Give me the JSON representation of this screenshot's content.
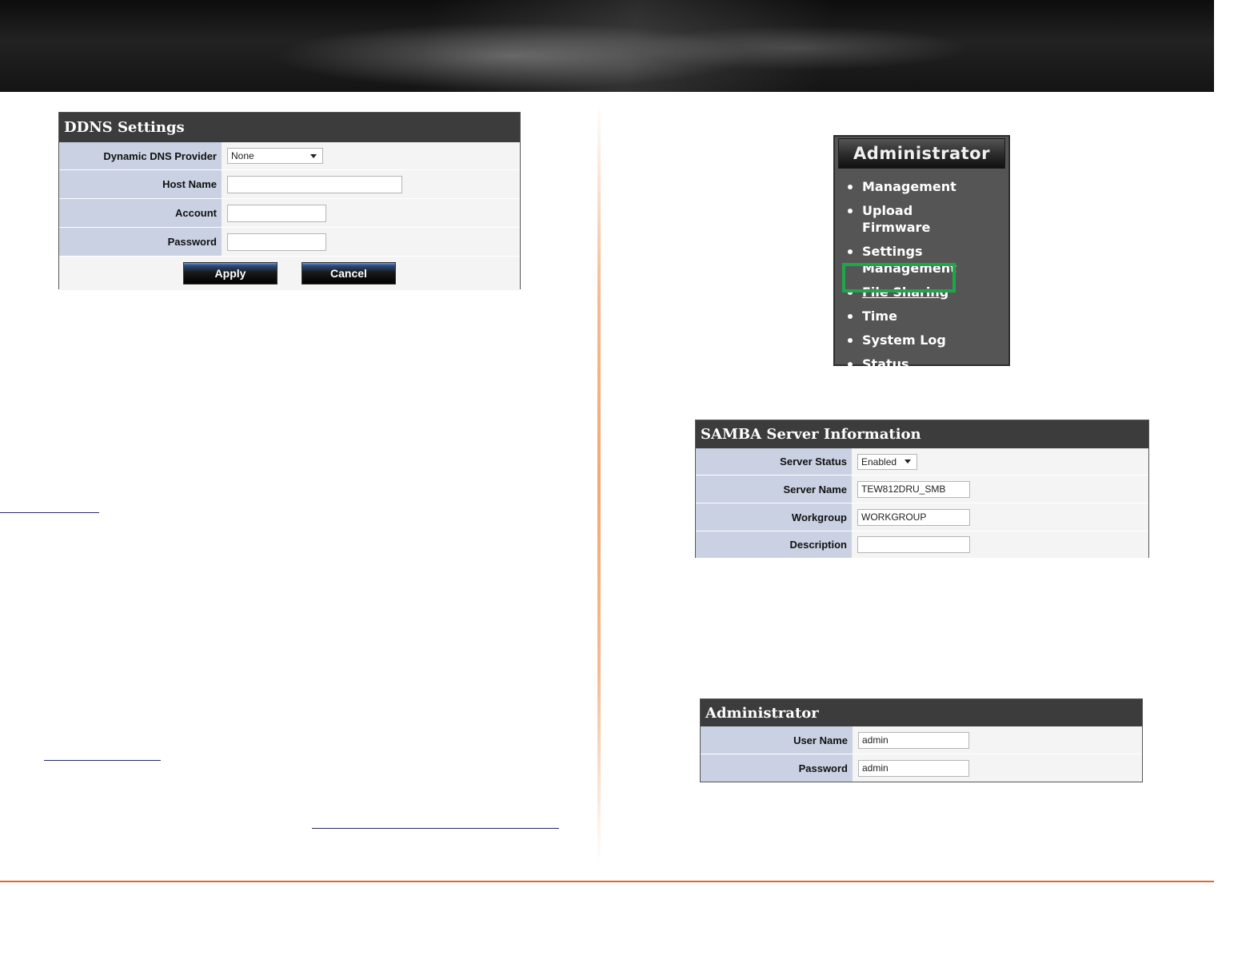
{
  "ddns": {
    "title": "DDNS Settings",
    "provider_label": "Dynamic DNS Provider",
    "provider_value": "None",
    "host_label": "Host Name",
    "host_value": "",
    "account_label": "Account",
    "account_value": "",
    "password_label": "Password",
    "password_value": "",
    "apply_label": "Apply",
    "cancel_label": "Cancel"
  },
  "admin_menu": {
    "title": "Administrator",
    "items": [
      "Management",
      "Upload Firmware",
      "Settings Management",
      "File Sharing",
      "Time",
      "System Log",
      "Status"
    ],
    "active_item": "File Sharing",
    "highlight_color": "#1fa64a"
  },
  "samba": {
    "title": "SAMBA Server Information",
    "status_label": "Server Status",
    "status_value": "Enabled",
    "name_label": "Server Name",
    "name_value": "TEW812DRU_SMB",
    "workgroup_label": "Workgroup",
    "workgroup_value": "WORKGROUP",
    "description_label": "Description",
    "description_value": ""
  },
  "admin_creds": {
    "title": "Administrator",
    "user_label": "User Name",
    "user_value": "admin",
    "password_label": "Password",
    "password_value": "admin"
  },
  "colors": {
    "panel_title_bg": "#3c3c3c",
    "label_bg": "#c9d1e3",
    "accent_orange": "#e06a2c"
  }
}
